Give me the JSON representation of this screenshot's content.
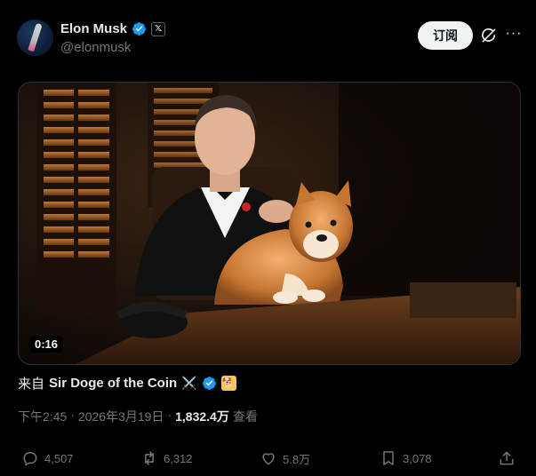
{
  "post": {
    "author_name": "Elon Musk",
    "handle": "@elonmusk",
    "subscribe_label": "订阅",
    "x_badge": "𝕏",
    "more_icon": "more-icon",
    "grok_icon": "grok-icon"
  },
  "media": {
    "duration": "0:16"
  },
  "source": {
    "label": "来自",
    "account": "Sir Doge of the Coin",
    "emoji": "⚔️",
    "flag_emoji": "🐕"
  },
  "meta": {
    "time": "下午2:45",
    "sep1": "·",
    "date": "2026年3月19日",
    "sep2": "·",
    "views": "1,832.4万",
    "views_label": "查看"
  },
  "actions": {
    "replies": "4,507",
    "reposts": "6,312",
    "likes": "5.8万",
    "bookmarks": "3,078"
  },
  "colors": {
    "background": "#000000",
    "verified": "#1d9bf0",
    "muted": "#71767b",
    "text": "#e7e9ea"
  }
}
